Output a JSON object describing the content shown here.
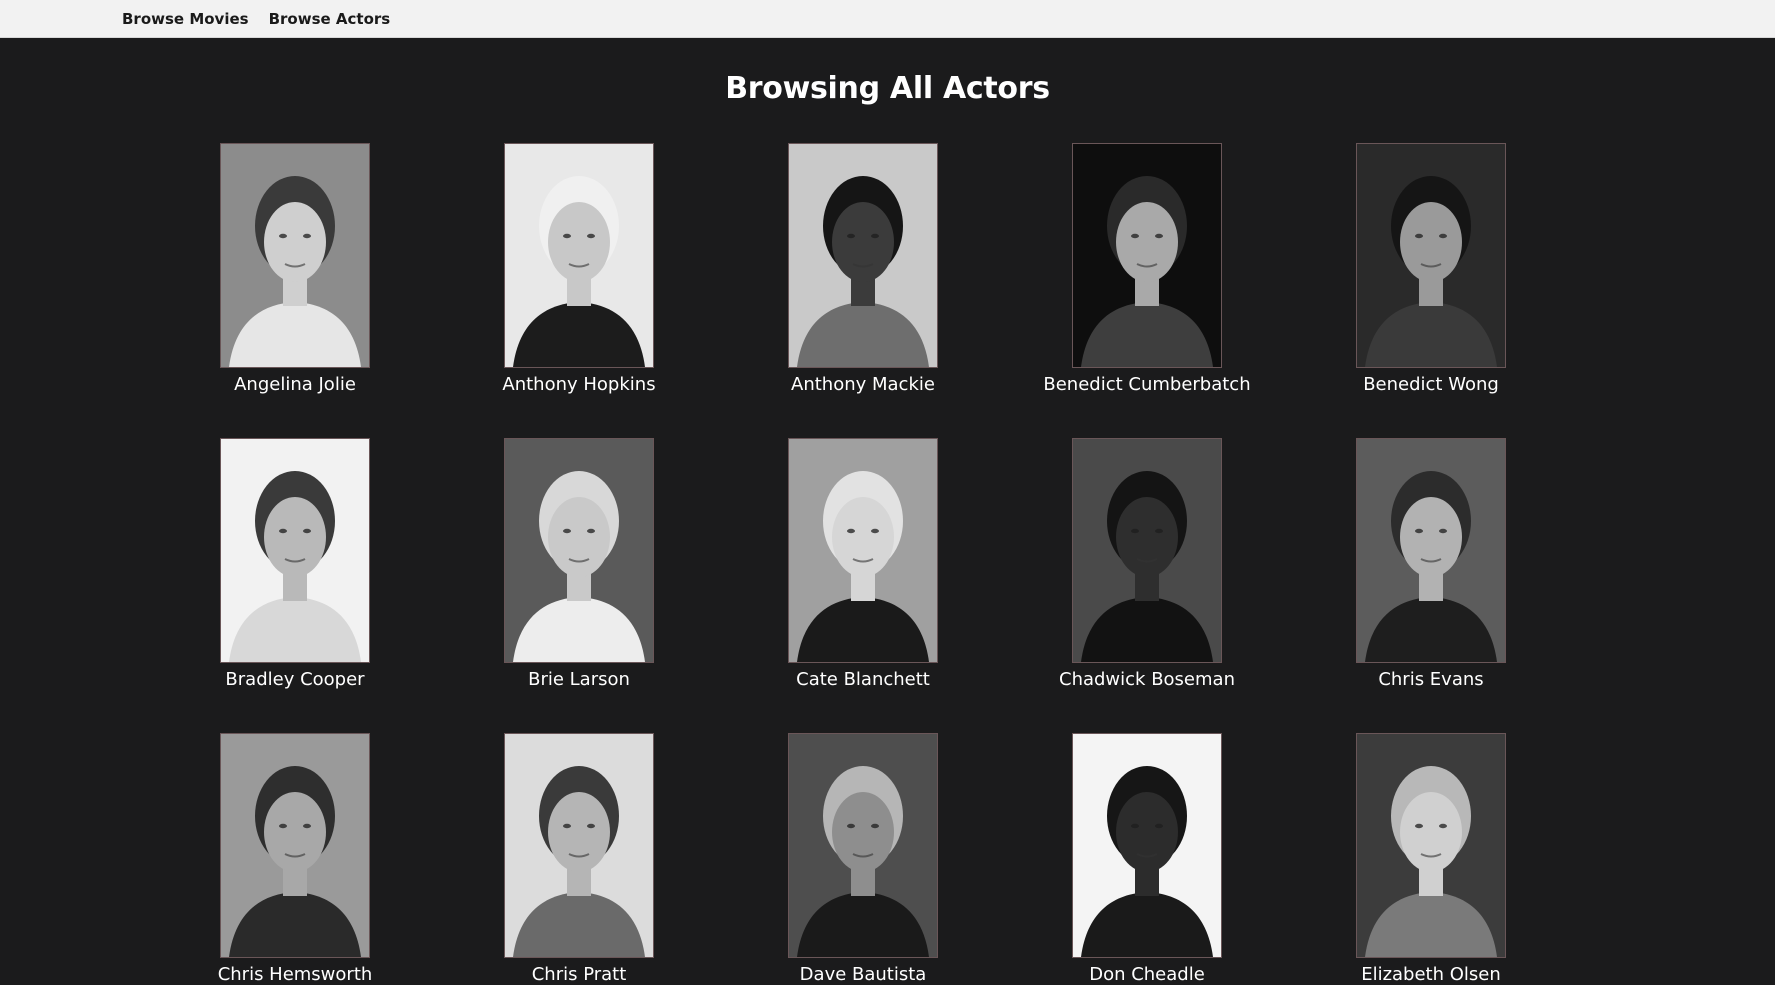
{
  "nav": {
    "links": [
      {
        "label": "Browse Movies"
      },
      {
        "label": "Browse Actors"
      }
    ]
  },
  "page_title": "Browsing All Actors",
  "actors": [
    {
      "name": "Angelina Jolie",
      "bg": "#8c8c8c",
      "skin": "#cfcfcf",
      "hair": "#3a3a3a",
      "shirt": "#e6e6e6"
    },
    {
      "name": "Anthony Hopkins",
      "bg": "#e8e8e8",
      "skin": "#c8c8c8",
      "hair": "#f0f0f0",
      "shirt": "#1c1c1c"
    },
    {
      "name": "Anthony Mackie",
      "bg": "#c9c9c9",
      "skin": "#3b3b3b",
      "hair": "#151515",
      "shirt": "#6e6e6e"
    },
    {
      "name": "Benedict Cumberbatch",
      "bg": "#0e0e0e",
      "skin": "#a9a9a9",
      "hair": "#2a2a2a",
      "shirt": "#3e3e3e"
    },
    {
      "name": "Benedict Wong",
      "bg": "#2a2a2a",
      "skin": "#9a9a9a",
      "hair": "#151515",
      "shirt": "#3a3a3a"
    },
    {
      "name": "Bradley Cooper",
      "bg": "#f2f2f2",
      "skin": "#b9b9b9",
      "hair": "#3a3a3a",
      "shirt": "#d8d8d8"
    },
    {
      "name": "Brie Larson",
      "bg": "#5a5a5a",
      "skin": "#c9c9c9",
      "hair": "#d8d8d8",
      "shirt": "#ededed"
    },
    {
      "name": "Cate Blanchett",
      "bg": "#a0a0a0",
      "skin": "#d6d6d6",
      "hair": "#e2e2e2",
      "shirt": "#1a1a1a"
    },
    {
      "name": "Chadwick Boseman",
      "bg": "#4a4a4a",
      "skin": "#2e2e2e",
      "hair": "#141414",
      "shirt": "#121212"
    },
    {
      "name": "Chris Evans",
      "bg": "#5c5c5c",
      "skin": "#b2b2b2",
      "hair": "#2c2c2c",
      "shirt": "#1e1e1e"
    },
    {
      "name": "Chris Hemsworth",
      "bg": "#9a9a9a",
      "skin": "#a8a8a8",
      "hair": "#2e2e2e",
      "shirt": "#2a2a2a"
    },
    {
      "name": "Chris Pratt",
      "bg": "#dcdcdc",
      "skin": "#b5b5b5",
      "hair": "#3a3a3a",
      "shirt": "#6a6a6a"
    },
    {
      "name": "Dave Bautista",
      "bg": "#4e4e4e",
      "skin": "#8e8e8e",
      "hair": "#b6b6b6",
      "shirt": "#1a1a1a"
    },
    {
      "name": "Don Cheadle",
      "bg": "#f4f4f4",
      "skin": "#2c2c2c",
      "hair": "#161616",
      "shirt": "#1a1a1a"
    },
    {
      "name": "Elizabeth Olsen",
      "bg": "#3c3c3c",
      "skin": "#d0d0d0",
      "hair": "#b8b8b8",
      "shirt": "#7a7a7a"
    }
  ]
}
